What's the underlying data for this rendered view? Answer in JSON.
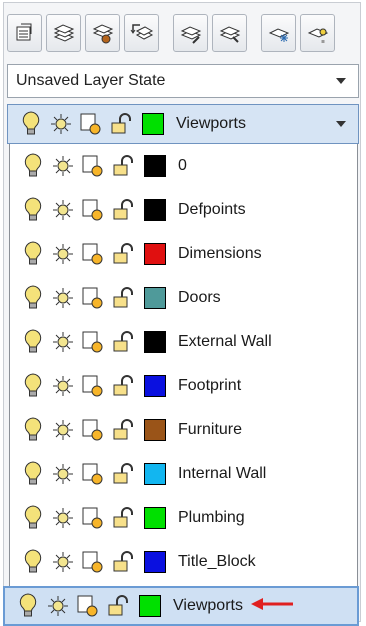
{
  "layer_state": {
    "value": "Unsaved Layer State"
  },
  "current_layer": {
    "name": "Viewports",
    "color": "#00e000"
  },
  "layers": [
    {
      "name": "0",
      "color": "#000000"
    },
    {
      "name": "Defpoints",
      "color": "#000000"
    },
    {
      "name": "Dimensions",
      "color": "#e01010"
    },
    {
      "name": "Doors",
      "color": "#4f9a9a"
    },
    {
      "name": "External Wall",
      "color": "#000000"
    },
    {
      "name": "Footprint",
      "color": "#0a10e0"
    },
    {
      "name": "Furniture",
      "color": "#9a5418"
    },
    {
      "name": "Internal Wall",
      "color": "#12b6f0"
    },
    {
      "name": "Plumbing",
      "color": "#00e000"
    },
    {
      "name": "Title_Block",
      "color": "#0a10e0"
    },
    {
      "name": "Viewports",
      "color": "#00e000"
    }
  ],
  "toolbar_icons": [
    "layer-properties-icon",
    "set-current-layer-icon",
    "layer-states-icon",
    "layer-previous-icon",
    "isolate-layer-icon",
    "unisolate-layer-icon",
    "freeze-layer-icon",
    "off-layer-icon"
  ],
  "colors": {
    "selection_bg": "#cfe0f3",
    "selection_border": "#6a9bd4",
    "pointer_arrow": "#e02020"
  }
}
